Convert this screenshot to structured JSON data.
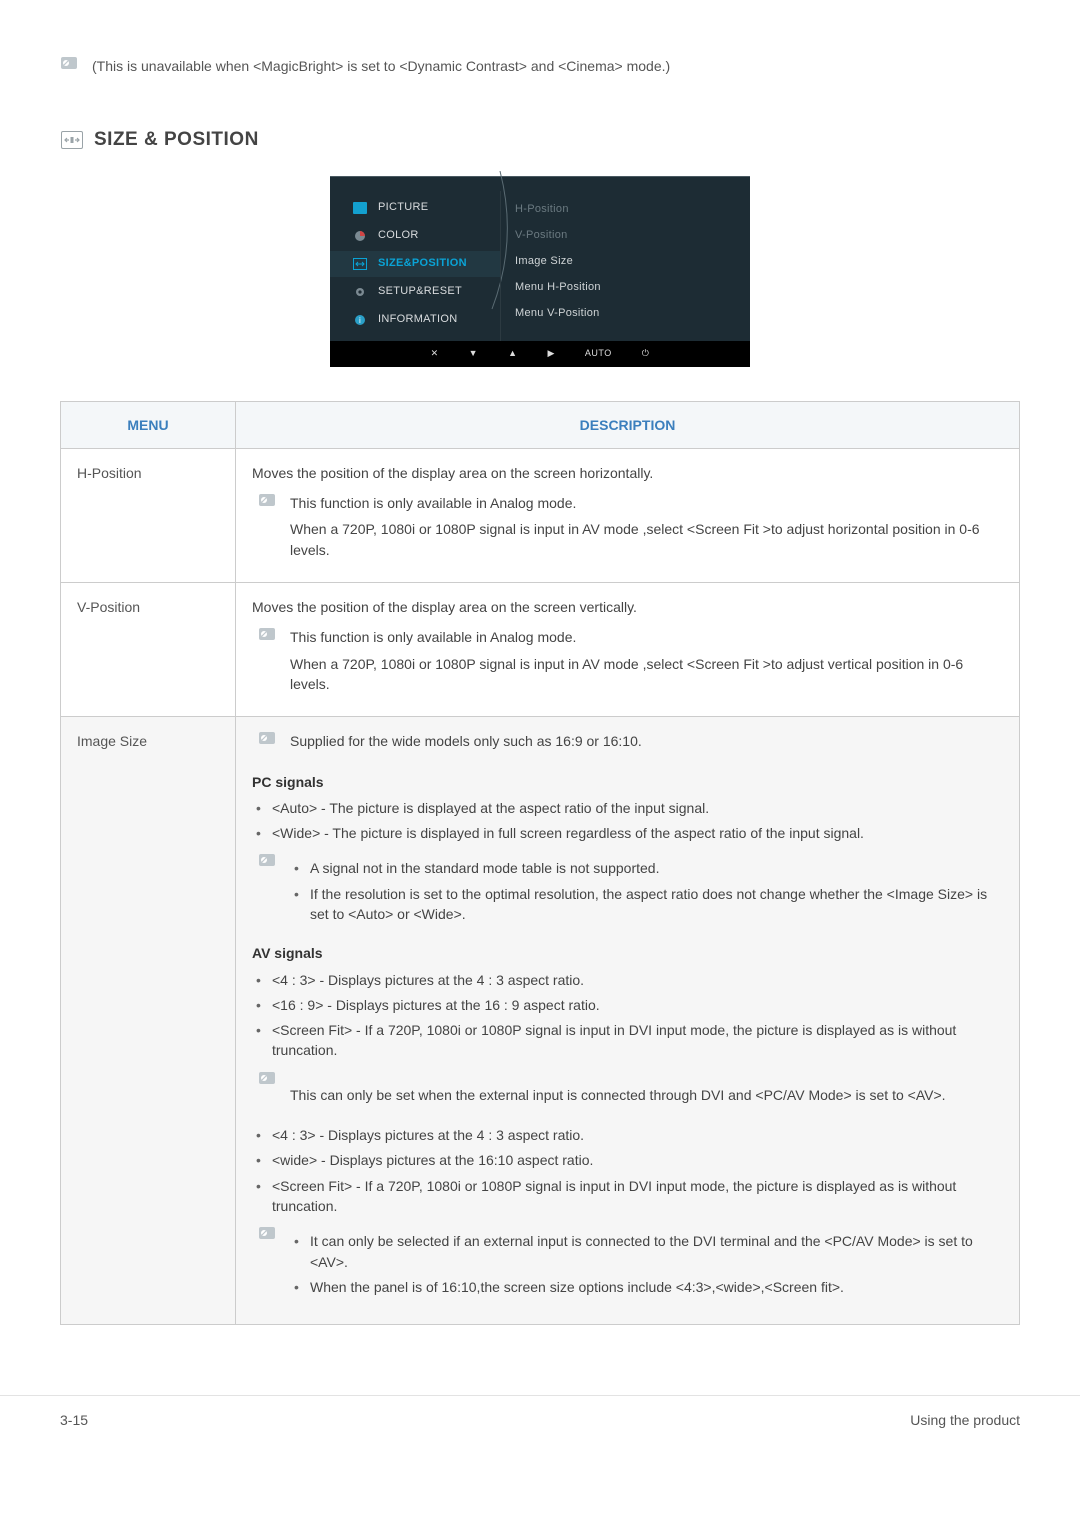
{
  "top_note": "(This is unavailable when <MagicBright> is set to <Dynamic Contrast> and <Cinema> mode.)",
  "section_title": "SIZE & POSITION",
  "osd": {
    "left": [
      {
        "icon": "picture-icon",
        "label": "PICTURE"
      },
      {
        "icon": "color-icon",
        "label": "COLOR"
      },
      {
        "icon": "sizepos-icon",
        "label": "SIZE&POSITION",
        "selected": true
      },
      {
        "icon": "gear-icon",
        "label": "SETUP&RESET"
      },
      {
        "icon": "info-icon",
        "label": "INFORMATION"
      }
    ],
    "right": [
      {
        "label": "H-Position",
        "dim": true
      },
      {
        "label": "V-Position",
        "dim": true
      },
      {
        "label": "Image Size",
        "dim": false
      },
      {
        "label": "Menu H-Position",
        "dim": false
      },
      {
        "label": "Menu V-Position",
        "dim": false
      }
    ],
    "footer": [
      "✕",
      "▼",
      "▲",
      "▶",
      "AUTO",
      "⏻"
    ]
  },
  "table": {
    "headers": {
      "menu": "MENU",
      "desc": "DESCRIPTION"
    },
    "rows": {
      "hpos": {
        "menu": "H-Position",
        "lead": "Moves the position of the display area on the screen horizontally.",
        "note_line1": "This function is only available in Analog mode.",
        "note_line2": "When a 720P, 1080i or 1080P signal is input in AV mode ,select <Screen Fit >to adjust horizontal position in 0-6 levels."
      },
      "vpos": {
        "menu": "V-Position",
        "lead": "Moves the position of the display area on the screen vertically.",
        "note_line1": "This function is only available in Analog mode.",
        "note_line2": "When a 720P, 1080i or 1080P signal is input in AV mode ,select <Screen Fit >to adjust vertical position in 0-6 levels."
      },
      "imagesize": {
        "menu": "Image Size",
        "top_note": "Supplied for the wide models only such as 16:9 or 16:10.",
        "pc_heading": "PC signals",
        "pc_b1": "<Auto> - The picture is displayed at the aspect ratio of the input signal.",
        "pc_b2": "<Wide> - The picture is displayed in full screen regardless of the aspect ratio of the input signal.",
        "pc_sub_b1": "A signal not in the standard mode table is not supported.",
        "pc_sub_b2": "If the resolution is set to the optimal resolution, the aspect ratio does not change whether the <Image Size> is set to <Auto> or <Wide>.",
        "av_heading": "AV signals",
        "av_b1": "<4 : 3> - Displays pictures at the 4 : 3 aspect ratio.",
        "av_b2": "<16 : 9> - Displays pictures at the 16 : 9 aspect ratio.",
        "av_b3": "<Screen Fit> - If a 720P, 1080i or 1080P signal is input in DVI input mode, the picture is displayed as is without truncation.",
        "av_note1": "This can only be set when the external input is connected through DVI and <PC/AV Mode> is set to <AV>.",
        "av_b4": "<4 : 3> - Displays pictures at the 4 : 3 aspect ratio.",
        "av_b5": "<wide> - Displays pictures at the 16:10 aspect ratio.",
        "av_b6": "<Screen Fit> - If a 720P, 1080i or 1080P signal is input in DVI input mode, the picture is displayed as is without truncation.",
        "av_note2_b1": "It can only be selected if an external input is connected to the DVI terminal and the <PC/AV Mode> is set to <AV>.",
        "av_note2_b2": "When the panel is of 16:10,the screen size options include <4:3>,<wide>,<Screen fit>."
      }
    }
  },
  "footer": {
    "left": "3-15",
    "right": "Using the product"
  }
}
